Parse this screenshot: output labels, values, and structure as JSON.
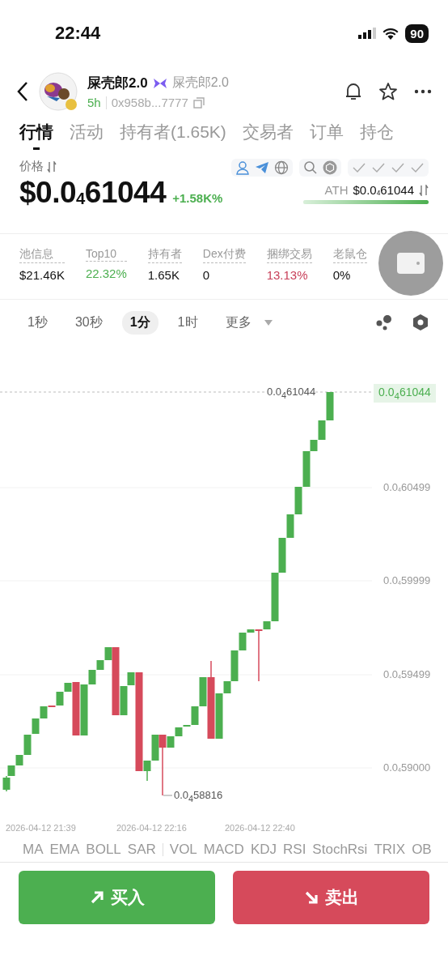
{
  "status_bar": {
    "time": "22:44",
    "battery": "90"
  },
  "token": {
    "name": "屎壳郎2.0",
    "symbol": "屎壳郎2.0",
    "age": "5h",
    "address": "0x958b...7777"
  },
  "tabs": [
    {
      "label": "行情",
      "selected": true
    },
    {
      "label": "活动",
      "selected": false
    },
    {
      "label": "持有者(1.65K)",
      "selected": false
    },
    {
      "label": "交易者",
      "selected": false
    },
    {
      "label": "订单",
      "selected": false
    },
    {
      "label": "持仓",
      "selected": false
    }
  ],
  "price": {
    "label": "价格",
    "value": "$0.0$_{4}$61044",
    "change": "+1.58K%",
    "ath_label": "ATH",
    "ath_value": "$0.0$_{4}$61044",
    "level": 1
  },
  "stats": [
    {
      "label": "池信息",
      "value": "$21.46K",
      "color": "#111111"
    },
    {
      "label": "Top10",
      "value": "22.32%",
      "color": "#4caf50"
    },
    {
      "label": "持有者",
      "value": "1.65K",
      "color": "#111111"
    },
    {
      "label": "Dex付费",
      "value": "0",
      "color": "#111111"
    },
    {
      "label": "捆绑交易",
      "value": "13.13%",
      "color": "#c8405a"
    },
    {
      "label": "老鼠仓",
      "value": "0%",
      "color": "#111111"
    }
  ],
  "timeframes": [
    {
      "label": "1秒",
      "selected": false
    },
    {
      "label": "30秒",
      "selected": false
    },
    {
      "label": "1分",
      "selected": true
    },
    {
      "label": "1时",
      "selected": false
    }
  ],
  "more": "更多",
  "chart": {
    "current": "0.0$_{4}$61044",
    "high": "0.0$_{4}$61044",
    "low": "0.0$_{4}$58816",
    "price_ticks": [
      "0.0$_{4}$60499",
      "0.0$_{4}$59999",
      "0.0$_{4}$59499",
      "0.0$_{4}$59000"
    ],
    "time_ticks": [
      "2026-04-12 21:39",
      "2026-04-12 22:16",
      "2026-04-12 22:40"
    ]
  },
  "indicators_main": [
    "MA",
    "EMA",
    "BOLL",
    "SAR"
  ],
  "indicators_sub": [
    "VOL",
    "MACD",
    "KDJ",
    "RSI",
    "StochRsi",
    "TRIX",
    "OB"
  ],
  "buy": "买入",
  "sell": "卖出"
}
